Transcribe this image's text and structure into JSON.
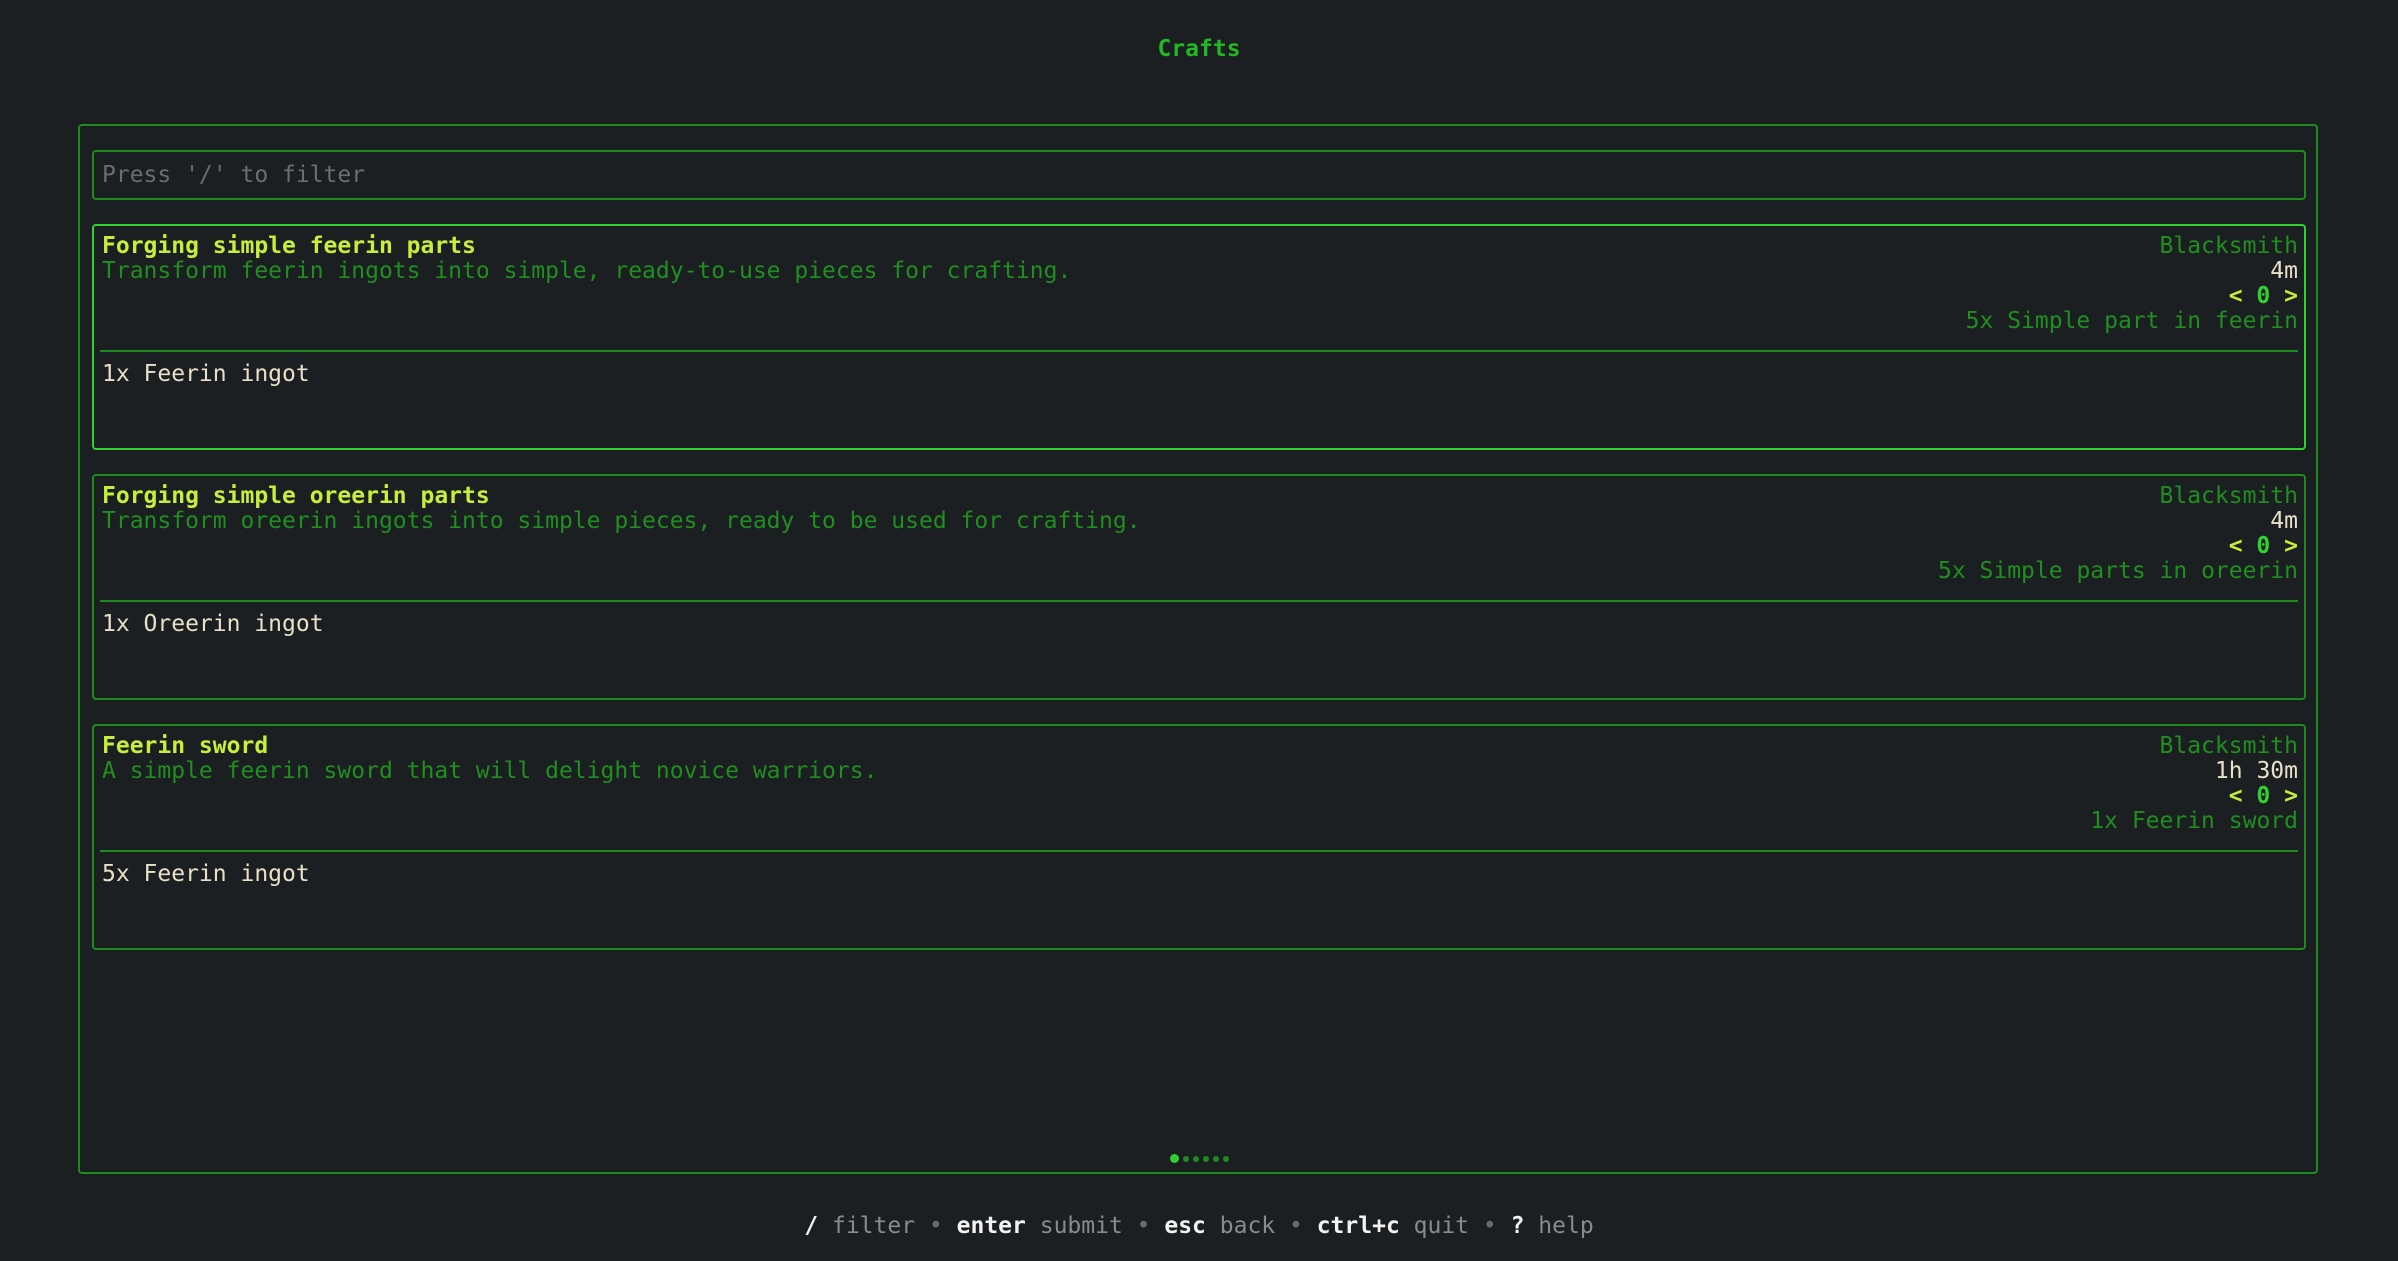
{
  "page_title": "Crafts",
  "filter": {
    "placeholder": "Press '/' to filter",
    "value": ""
  },
  "crafts": [
    {
      "name": "Forging simple feerin parts",
      "description": "Transform feerin ingots into simple, ready-to-use pieces for crafting.",
      "category": "Blacksmith",
      "duration": "4m",
      "quantity": "0",
      "output": "5x Simple part in feerin",
      "ingredient": "1x Feerin ingot",
      "selected": true
    },
    {
      "name": "Forging simple oreerin parts",
      "description": "Transform oreerin ingots into simple pieces, ready to be used for crafting.",
      "category": "Blacksmith",
      "duration": "4m",
      "quantity": "0",
      "output": "5x Simple parts in oreerin",
      "ingredient": "1x Oreerin ingot",
      "selected": false
    },
    {
      "name": "Feerin sword",
      "description": "A simple feerin sword that will delight novice warriors.",
      "category": "Blacksmith",
      "duration": "1h 30m",
      "quantity": "0",
      "output": "1x Feerin sword",
      "ingredient": "5x Feerin ingot",
      "selected": false
    }
  ],
  "qty_controls": {
    "decrease": "<",
    "increase": ">"
  },
  "pagination": {
    "pages": 6,
    "current": 1
  },
  "help": [
    {
      "key": "/",
      "desc": "filter"
    },
    {
      "key": "enter",
      "desc": "submit"
    },
    {
      "key": "esc",
      "desc": "back"
    },
    {
      "key": "ctrl+c",
      "desc": "quit"
    },
    {
      "key": "?",
      "desc": "help"
    }
  ],
  "help_separator": "•",
  "colors": {
    "background": "#1c1f21",
    "border": "#1f8a1f",
    "border_selected": "#2fd02f",
    "title_green": "#22b822",
    "item_name": "#c6ee3a",
    "muted_green": "#1f8f1f",
    "text": "#e8e0c8"
  }
}
